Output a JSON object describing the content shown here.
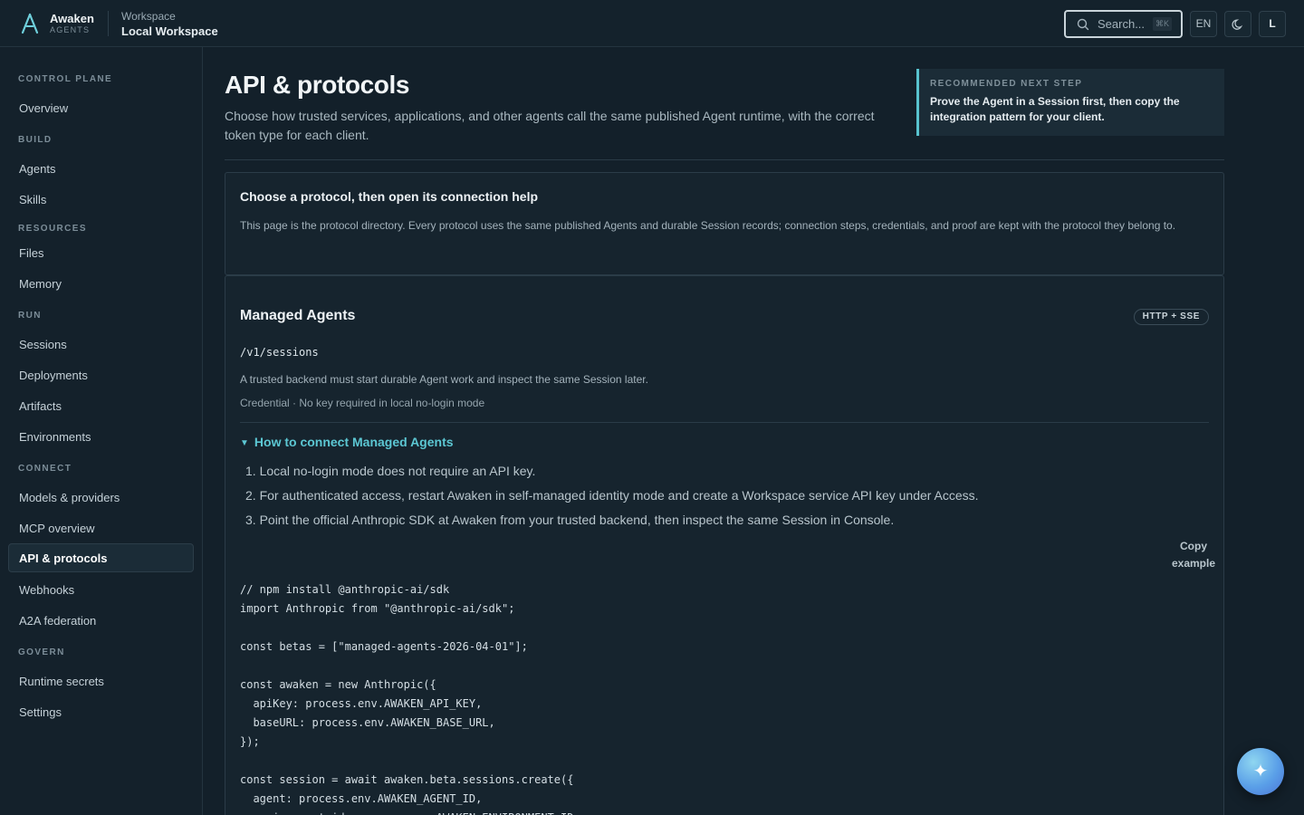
{
  "header": {
    "brand_name": "Awaken",
    "brand_sub": "AGENTS",
    "workspace_label": "Workspace",
    "workspace_name": "Local Workspace",
    "search_placeholder": "Search...",
    "search_shortcut": "⌘K",
    "language": "EN",
    "user_initial": "L"
  },
  "sidebar": {
    "sections": [
      {
        "title": "CONTROL PLANE",
        "items": [
          "Overview"
        ]
      },
      {
        "title": "BUILD",
        "items": [
          "Agents",
          "Skills"
        ]
      },
      {
        "title": "RESOURCES",
        "items": [
          "Files",
          "Memory"
        ]
      },
      {
        "title": "RUN",
        "items": [
          "Sessions",
          "Deployments",
          "Artifacts",
          "Environments"
        ]
      },
      {
        "title": "CONNECT",
        "items": [
          "Models & providers",
          "MCP overview",
          "API & protocols",
          "Webhooks",
          "A2A federation"
        ]
      },
      {
        "title": "GOVERN",
        "items": [
          "Runtime secrets",
          "Settings"
        ]
      }
    ],
    "active_item": "API & protocols"
  },
  "main": {
    "title": "API & protocols",
    "description": "Choose how trusted services, applications, and other agents call the same published Agent runtime, with the correct token type for each client.",
    "next_step": {
      "label": "RECOMMENDED NEXT STEP",
      "text": "Prove the Agent in a Session first, then copy the integration pattern for your client."
    },
    "intro_card": {
      "title": "Choose a protocol, then open its connection help",
      "text": "This page is the protocol directory. Every protocol uses the same published Agents and durable Session records; connection steps, credentials, and proof are kept with the protocol they belong to."
    },
    "protocol": {
      "title": "Managed Agents",
      "badge": "HTTP + SSE",
      "path": "/v1/sessions",
      "description": "A trusted backend must start durable Agent work and inspect the same Session later.",
      "credential": "Credential · No key required in local no-login mode",
      "howto_label": "How to connect Managed Agents",
      "steps": [
        "1. Local no-login mode does not require an API key.",
        "2. For authenticated access, restart Awaken in self-managed identity mode and create a Workspace service API key under Access.",
        "3. Point the official Anthropic SDK at Awaken from your trusted backend, then inspect the same Session in Console."
      ],
      "copy_label_1": "Copy",
      "copy_label_2": "example",
      "code": "// npm install @anthropic-ai/sdk\nimport Anthropic from \"@anthropic-ai/sdk\";\n\nconst betas = [\"managed-agents-2026-04-01\"];\n\nconst awaken = new Anthropic({\n  apiKey: process.env.AWAKEN_API_KEY,\n  baseURL: process.env.AWAKEN_BASE_URL,\n});\n\nconst session = await awaken.beta.sessions.create({\n  agent: process.env.AWAKEN_AGENT_ID,\n  environment_id: process.env.AWAKEN_ENVIRONMENT_ID,"
    }
  },
  "fab_icon": "sparkle-icon"
}
